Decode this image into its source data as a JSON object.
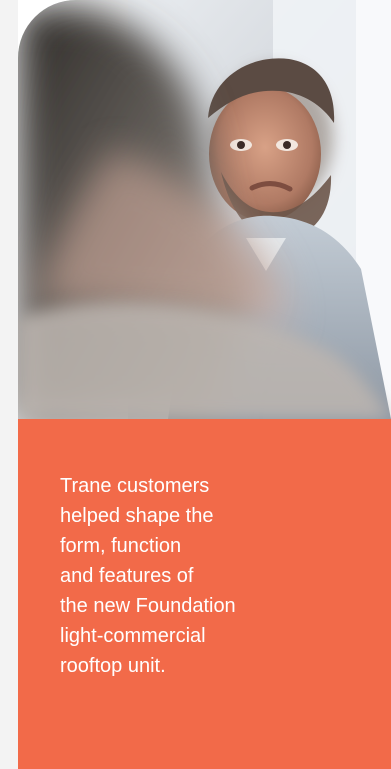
{
  "caption": {
    "text": "Trane customers\nhelped shape the\nform, function\nand features of\nthe new Foundation\nlight-commercial\nrooftop unit."
  },
  "colors": {
    "accent_panel": "#f26a49",
    "caption_text": "#ffffff"
  },
  "photo": {
    "icon": "meeting-photo-icon",
    "description_hidden": false
  }
}
